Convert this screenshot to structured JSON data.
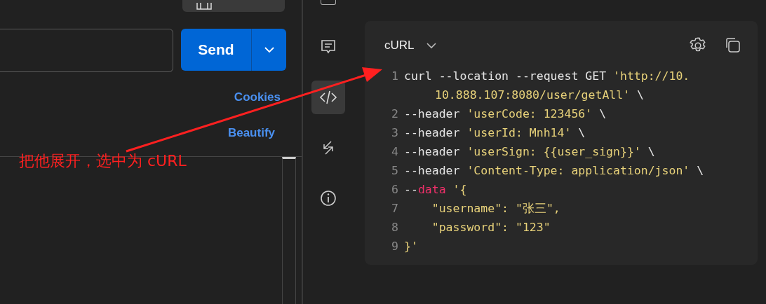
{
  "request": {
    "send_button": "Send",
    "cookies_link": "Cookies",
    "beautify_link": "Beautify"
  },
  "sidebar": {
    "items": [
      {
        "kind": "comment",
        "selected": false
      },
      {
        "kind": "code",
        "selected": true
      },
      {
        "kind": "arrows",
        "selected": false
      },
      {
        "kind": "info",
        "selected": false
      }
    ]
  },
  "code_snippet": {
    "language": "cURL",
    "lines": [
      {
        "number": "1",
        "rows": [
          [
            {
              "kind": "plain",
              "text": "curl --location --request GET "
            },
            {
              "kind": "string",
              "text": "'http://10."
            }
          ],
          [
            {
              "kind": "string",
              "text": "10.888.107:8080/user/getAll'"
            },
            {
              "kind": "plain",
              "text": " \\"
            }
          ]
        ]
      },
      {
        "number": "2",
        "rows": [
          [
            {
              "kind": "plain",
              "text": "--header "
            },
            {
              "kind": "string",
              "text": "'userCode: 123456'"
            },
            {
              "kind": "plain",
              "text": " \\"
            }
          ]
        ]
      },
      {
        "number": "3",
        "rows": [
          [
            {
              "kind": "plain",
              "text": "--header "
            },
            {
              "kind": "string",
              "text": "'userId: Mnh14'"
            },
            {
              "kind": "plain",
              "text": " \\"
            }
          ]
        ]
      },
      {
        "number": "4",
        "rows": [
          [
            {
              "kind": "plain",
              "text": "--header "
            },
            {
              "kind": "string",
              "text": "'userSign: {{user_sign}}'"
            },
            {
              "kind": "plain",
              "text": " \\"
            }
          ]
        ]
      },
      {
        "number": "5",
        "rows": [
          [
            {
              "kind": "plain",
              "text": "--header "
            },
            {
              "kind": "string",
              "text": "'Content-Type: application/json'"
            },
            {
              "kind": "plain",
              "text": " \\"
            }
          ]
        ]
      },
      {
        "number": "6",
        "rows": [
          [
            {
              "kind": "plain",
              "text": "--"
            },
            {
              "kind": "keyword",
              "text": "data"
            },
            {
              "kind": "plain",
              "text": " "
            },
            {
              "kind": "string",
              "text": "'{"
            }
          ]
        ]
      },
      {
        "number": "7",
        "rows": [
          [
            {
              "kind": "string",
              "text": "    \"username\": \"张三\","
            }
          ]
        ]
      },
      {
        "number": "8",
        "rows": [
          [
            {
              "kind": "string",
              "text": "    \"password\": \"123\""
            }
          ]
        ]
      },
      {
        "number": "9",
        "rows": [
          [
            {
              "kind": "string",
              "text": "}'"
            }
          ]
        ]
      }
    ]
  },
  "annotation": {
    "text": "把他展开，选中为 cURL"
  }
}
